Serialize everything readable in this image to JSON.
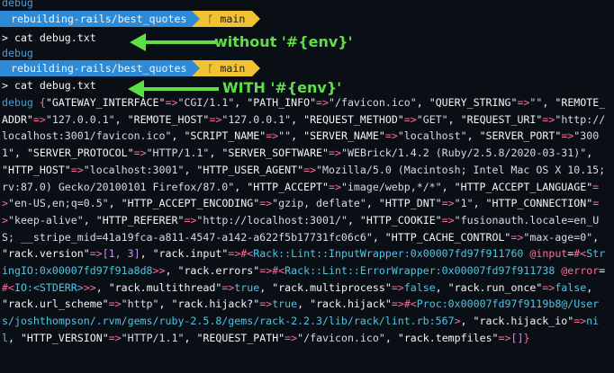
{
  "terminal": {
    "debug_label": "debug",
    "prompt": {
      "path": "rebuilding-rails/best_quotes",
      "branch_icon": "git-branch-icon",
      "branch": "main"
    },
    "command_prefix": "> ",
    "command": "cat debug.txt"
  },
  "annotations": {
    "without_env": "without '#{env}'",
    "with_env": "WITH '#{env}'",
    "color": "#5ce046"
  },
  "output_tokens": [
    {
      "t": "debug ",
      "c": "debug"
    },
    {
      "t": "{",
      "c": "br"
    },
    {
      "t": "\"GATEWAY_INTERFACE\"",
      "c": "k"
    },
    {
      "t": "=>",
      "c": "op"
    },
    {
      "t": "\"CGI/1.1\"",
      "c": "s"
    },
    {
      "t": ", ",
      "c": "k"
    },
    {
      "t": "\"PATH_INFO\"",
      "c": "k"
    },
    {
      "t": "=>",
      "c": "op"
    },
    {
      "t": "\"/favicon.ico\"",
      "c": "s"
    },
    {
      "t": ", ",
      "c": "k"
    },
    {
      "t": "\"QUERY_STRING\"",
      "c": "k"
    },
    {
      "t": "=>",
      "c": "op"
    },
    {
      "t": "\"\"",
      "c": "s"
    },
    {
      "t": ", ",
      "c": "k"
    },
    {
      "t": "\"REMOTE_ADDR\"",
      "c": "k"
    },
    {
      "t": "=>",
      "c": "op"
    },
    {
      "t": "\"127.0.0.1\"",
      "c": "s"
    },
    {
      "t": ", ",
      "c": "k"
    },
    {
      "t": "\"REMOTE_HOST\"",
      "c": "k"
    },
    {
      "t": "=>",
      "c": "op"
    },
    {
      "t": "\"127.0.0.1\"",
      "c": "s"
    },
    {
      "t": ", ",
      "c": "k"
    },
    {
      "t": "\"REQUEST_METHOD\"",
      "c": "k"
    },
    {
      "t": "=>",
      "c": "op"
    },
    {
      "t": "\"GET\"",
      "c": "s"
    },
    {
      "t": ", ",
      "c": "k"
    },
    {
      "t": "\"REQUEST_URI\"",
      "c": "k"
    },
    {
      "t": "=>",
      "c": "op"
    },
    {
      "t": "\"http://localhost:3001/favicon.ico\"",
      "c": "s"
    },
    {
      "t": ", ",
      "c": "k"
    },
    {
      "t": "\"SCRIPT_NAME\"",
      "c": "k"
    },
    {
      "t": "=>",
      "c": "op"
    },
    {
      "t": "\"\"",
      "c": "s"
    },
    {
      "t": ", ",
      "c": "k"
    },
    {
      "t": "\"SERVER_NAME\"",
      "c": "k"
    },
    {
      "t": "=>",
      "c": "op"
    },
    {
      "t": "\"localhost\"",
      "c": "s"
    },
    {
      "t": ", ",
      "c": "k"
    },
    {
      "t": "\"SERVER_PORT\"",
      "c": "k"
    },
    {
      "t": "=>",
      "c": "op"
    },
    {
      "t": "\"3001\"",
      "c": "s"
    },
    {
      "t": ", ",
      "c": "k"
    },
    {
      "t": "\"SERVER_PROTOCOL\"",
      "c": "k"
    },
    {
      "t": "=>",
      "c": "op"
    },
    {
      "t": "\"HTTP/1.1\"",
      "c": "s"
    },
    {
      "t": ", ",
      "c": "k"
    },
    {
      "t": "\"SERVER_SOFTWARE\"",
      "c": "k"
    },
    {
      "t": "=>",
      "c": "op"
    },
    {
      "t": "\"WEBrick/1.4.2 (Ruby/2.5.8/2020-03-31)\"",
      "c": "s"
    },
    {
      "t": ", ",
      "c": "k"
    },
    {
      "t": "\"HTTP_HOST\"",
      "c": "k"
    },
    {
      "t": "=>",
      "c": "op"
    },
    {
      "t": "\"localhost:3001\"",
      "c": "s"
    },
    {
      "t": ", ",
      "c": "k"
    },
    {
      "t": "\"HTTP_USER_AGENT\"",
      "c": "k"
    },
    {
      "t": "=>",
      "c": "op"
    },
    {
      "t": "\"Mozilla/5.0 (Macintosh; Intel Mac OS X 10.15; rv:87.0) Gecko/20100101 Firefox/87.0\"",
      "c": "s"
    },
    {
      "t": ", ",
      "c": "k"
    },
    {
      "t": "\"HTTP_ACCEPT\"",
      "c": "k"
    },
    {
      "t": "=>",
      "c": "op"
    },
    {
      "t": "\"image/webp,*/*\"",
      "c": "s"
    },
    {
      "t": ", ",
      "c": "k"
    },
    {
      "t": "\"HTTP_ACCEPT_LANGUAGE\"",
      "c": "k"
    },
    {
      "t": "=>",
      "c": "op"
    },
    {
      "t": "\"en-US,en;q=0.5\"",
      "c": "s"
    },
    {
      "t": ", ",
      "c": "k"
    },
    {
      "t": "\"HTTP_ACCEPT_ENCODING\"",
      "c": "k"
    },
    {
      "t": "=>",
      "c": "op"
    },
    {
      "t": "\"gzip, deflate\"",
      "c": "s"
    },
    {
      "t": ", ",
      "c": "k"
    },
    {
      "t": "\"HTTP_DNT\"",
      "c": "k"
    },
    {
      "t": "=>",
      "c": "op"
    },
    {
      "t": "\"1\"",
      "c": "s"
    },
    {
      "t": ", ",
      "c": "k"
    },
    {
      "t": "\"HTTP_CONNECTION\"",
      "c": "k"
    },
    {
      "t": "=>",
      "c": "op"
    },
    {
      "t": "\"keep-alive\"",
      "c": "s"
    },
    {
      "t": ", ",
      "c": "k"
    },
    {
      "t": "\"HTTP_REFERER\"",
      "c": "k"
    },
    {
      "t": "=>",
      "c": "op"
    },
    {
      "t": "\"http://localhost:3001/\"",
      "c": "s"
    },
    {
      "t": ", ",
      "c": "k"
    },
    {
      "t": "\"HTTP_COOKIE\"",
      "c": "k"
    },
    {
      "t": "=>",
      "c": "op"
    },
    {
      "t": "\"fusionauth.locale=en_US; __stripe_mid=41a19fca-a811-4547-a142-a622f5b17731fc06c6\"",
      "c": "s"
    },
    {
      "t": ", ",
      "c": "k"
    },
    {
      "t": "\"HTTP_CACHE_CONTROL\"",
      "c": "k"
    },
    {
      "t": "=>",
      "c": "op"
    },
    {
      "t": "\"max-age=0\"",
      "c": "s"
    },
    {
      "t": ", ",
      "c": "k"
    },
    {
      "t": "\"rack.version\"",
      "c": "k"
    },
    {
      "t": "=>",
      "c": "op"
    },
    {
      "t": "[1, 3]",
      "c": "num"
    },
    {
      "t": ", ",
      "c": "k"
    },
    {
      "t": "\"rack.input\"",
      "c": "k"
    },
    {
      "t": "=>",
      "c": "op"
    },
    {
      "t": "#<",
      "c": "br"
    },
    {
      "t": "Rack::Lint::InputWrapper",
      "c": "cls"
    },
    {
      "t": ":0x00007fd97f911760 ",
      "c": "addr"
    },
    {
      "t": "@input",
      "c": "op"
    },
    {
      "t": "=",
      "c": "k"
    },
    {
      "t": "#<",
      "c": "br"
    },
    {
      "t": "StringIO",
      "c": "cls"
    },
    {
      "t": ":0x00007fd97f91a8d8",
      "c": "addr"
    },
    {
      "t": ">>",
      "c": "br"
    },
    {
      "t": ", ",
      "c": "k"
    },
    {
      "t": "\"rack.errors\"",
      "c": "k"
    },
    {
      "t": "=>",
      "c": "op"
    },
    {
      "t": "#<",
      "c": "br"
    },
    {
      "t": "Rack::Lint::ErrorWrapper",
      "c": "cls"
    },
    {
      "t": ":0x00007fd97f911738 ",
      "c": "addr"
    },
    {
      "t": "@error",
      "c": "op"
    },
    {
      "t": "=",
      "c": "k"
    },
    {
      "t": "#<",
      "c": "br"
    },
    {
      "t": "IO:<STDERR>",
      "c": "cls"
    },
    {
      "t": ">>",
      "c": "br"
    },
    {
      "t": ", ",
      "c": "k"
    },
    {
      "t": "\"rack.multithread\"",
      "c": "k"
    },
    {
      "t": "=>",
      "c": "op"
    },
    {
      "t": "true",
      "c": "kw"
    },
    {
      "t": ", ",
      "c": "k"
    },
    {
      "t": "\"rack.multiprocess\"",
      "c": "k"
    },
    {
      "t": "=>",
      "c": "op"
    },
    {
      "t": "false",
      "c": "kw"
    },
    {
      "t": ", ",
      "c": "k"
    },
    {
      "t": "\"rack.run_once\"",
      "c": "k"
    },
    {
      "t": "=>",
      "c": "op"
    },
    {
      "t": "false",
      "c": "kw"
    },
    {
      "t": ", ",
      "c": "k"
    },
    {
      "t": "\"rack.url_scheme\"",
      "c": "k"
    },
    {
      "t": "=>",
      "c": "op"
    },
    {
      "t": "\"http\"",
      "c": "s"
    },
    {
      "t": ", ",
      "c": "k"
    },
    {
      "t": "\"rack.hijack?\"",
      "c": "k"
    },
    {
      "t": "=>",
      "c": "op"
    },
    {
      "t": "true",
      "c": "kw"
    },
    {
      "t": ", ",
      "c": "k"
    },
    {
      "t": "\"rack.hijack\"",
      "c": "k"
    },
    {
      "t": "=>",
      "c": "op"
    },
    {
      "t": "#<",
      "c": "br"
    },
    {
      "t": "Proc",
      "c": "cls"
    },
    {
      "t": ":0x00007fd97f9119b8",
      "c": "addr"
    },
    {
      "t": "@/Users/joshthompson/.rvm/gems/ruby-2.5.8/gems/rack-2.2.3/lib/rack/lint.rb:567",
      "c": "cls"
    },
    {
      "t": ">",
      "c": "br"
    },
    {
      "t": ", ",
      "c": "k"
    },
    {
      "t": "\"rack.hijack_io\"",
      "c": "k"
    },
    {
      "t": "=>",
      "c": "op"
    },
    {
      "t": "nil",
      "c": "kw"
    },
    {
      "t": ", ",
      "c": "k"
    },
    {
      "t": "\"HTTP_VERSION\"",
      "c": "k"
    },
    {
      "t": "=>",
      "c": "op"
    },
    {
      "t": "\"HTTP/1.1\"",
      "c": "s"
    },
    {
      "t": ", ",
      "c": "k"
    },
    {
      "t": "\"REQUEST_PATH\"",
      "c": "k"
    },
    {
      "t": "=>",
      "c": "op"
    },
    {
      "t": "\"/favicon.ico\"",
      "c": "s"
    },
    {
      "t": ", ",
      "c": "k"
    },
    {
      "t": "\"rack.tempfiles\"",
      "c": "k"
    },
    {
      "t": "=>",
      "c": "op"
    },
    {
      "t": "[]",
      "c": "num"
    },
    {
      "t": "}",
      "c": "br"
    }
  ]
}
